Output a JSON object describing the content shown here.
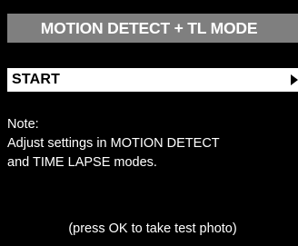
{
  "screen": {
    "title": "MOTION DETECT + TL MODE"
  },
  "menu": {
    "items": [
      {
        "label": "START"
      }
    ]
  },
  "note": {
    "heading": "Note:",
    "lines": [
      "Adjust settings in MOTION DETECT",
      "and TIME LAPSE modes."
    ]
  },
  "hint": {
    "text": "(press OK to take test photo)"
  },
  "colors": {
    "background": "#000000",
    "title_bar": "#7f7f7f",
    "selected_item_bg": "#ffffff",
    "selected_item_text": "#000000",
    "text": "#ffffff"
  },
  "icons": {
    "selected_item_arrow": "right-triangle-arrow-icon"
  }
}
